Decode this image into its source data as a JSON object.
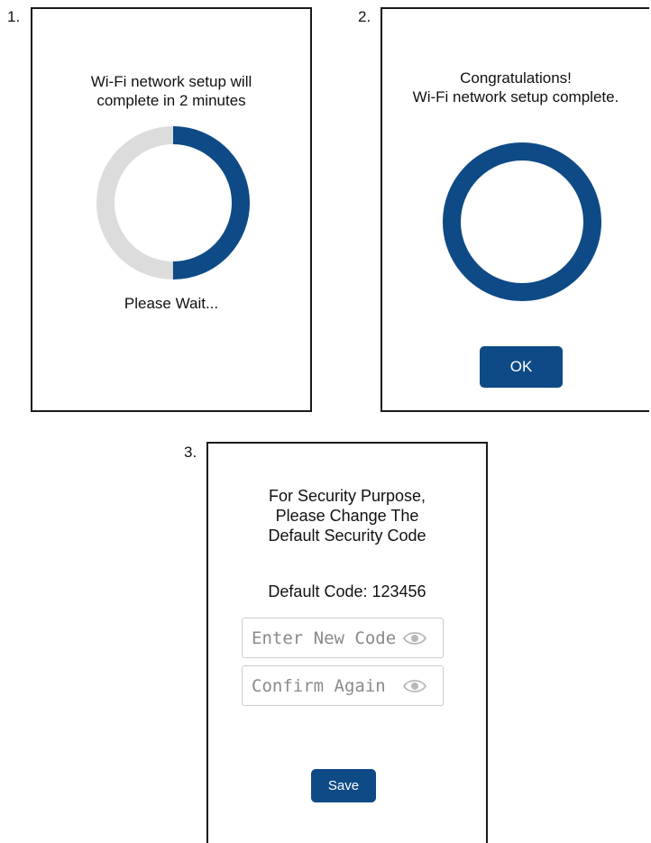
{
  "steps": [
    {
      "number": "1.",
      "message": "Wi-Fi network setup will\ncomplete in 2 minutes",
      "progress_fraction": 0.5,
      "status": "Please Wait..."
    },
    {
      "number": "2.",
      "message": "Congratulations!\nWi-Fi network setup complete.",
      "progress_fraction": 1.0,
      "ok_label": "OK"
    },
    {
      "number": "3.",
      "message": "For Security Purpose,\nPlease Change The\nDefault Security Code",
      "default_code_label": "Default Code: 123456",
      "new_code_placeholder": "Enter New Code",
      "confirm_placeholder": "Confirm Again",
      "save_label": "Save"
    }
  ],
  "icons": {
    "show_password": "eye-icon"
  },
  "colors": {
    "accent": "#0e4a86",
    "track": "#dcdcdc",
    "border": "#1a1a1a"
  }
}
